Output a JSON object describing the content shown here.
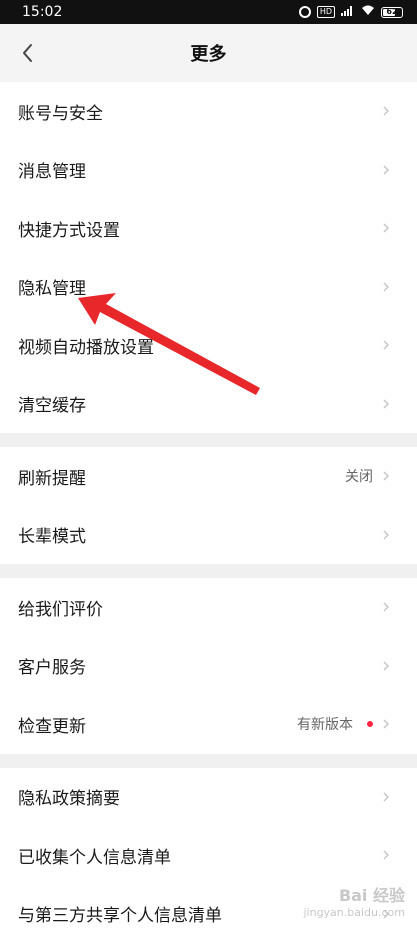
{
  "status": {
    "time": "15:02",
    "battery": "62"
  },
  "header": {
    "title": "更多"
  },
  "groups": [
    {
      "items": [
        {
          "label": "账号与安全"
        },
        {
          "label": "消息管理"
        },
        {
          "label": "快捷方式设置"
        },
        {
          "label": "隐私管理"
        },
        {
          "label": "视频自动播放设置"
        },
        {
          "label": "清空缓存"
        }
      ]
    },
    {
      "items": [
        {
          "label": "刷新提醒",
          "value": "关闭"
        },
        {
          "label": "长辈模式"
        }
      ]
    },
    {
      "items": [
        {
          "label": "给我们评价"
        },
        {
          "label": "客户服务"
        },
        {
          "label": "检查更新",
          "value": "有新版本"
        }
      ]
    },
    {
      "items": [
        {
          "label": "隐私政策摘要"
        },
        {
          "label": "已收集个人信息清单"
        },
        {
          "label": "与第三方共享个人信息清单"
        }
      ]
    }
  ],
  "annotation": {
    "color": "#e8272b"
  },
  "watermark": {
    "brand": "Bai 经验",
    "url": "jingyan.baidu.com"
  },
  "colors": {
    "badge": "#ff2442"
  }
}
